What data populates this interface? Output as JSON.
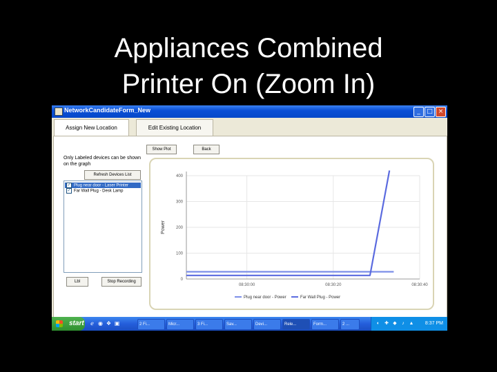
{
  "slide": {
    "title_line1": "Appliances Combined",
    "title_line2": "Printer On (Zoom In)"
  },
  "window": {
    "title": "NetworkCandidateForm_New",
    "controls": {
      "minimize": "_",
      "maximize": "□",
      "close": "×"
    }
  },
  "tabs": [
    {
      "label": "Assign New Location",
      "active": true
    },
    {
      "label": "Edit Existing Location",
      "active": false
    }
  ],
  "toolbar": {
    "btn1": "Show Plot",
    "btn2": "Back"
  },
  "left_panel": {
    "info": "Only Labeled devices can be shown on the graph",
    "refresh_button": "Refresh Devices List",
    "devices": [
      {
        "label": "Plug near door - Laser Printer",
        "checked": true,
        "selected": true
      },
      {
        "label": "Far Wall Plug - Desk Lamp",
        "checked": true,
        "selected": false
      }
    ],
    "bottom_left_button": "Lbl",
    "stop_button": "Stop Recording"
  },
  "chart_data": {
    "type": "line",
    "ylabel": "Power",
    "ylim": [
      0,
      400
    ],
    "yticks": [
      "400",
      "300",
      "200",
      "100",
      "0"
    ],
    "xticks": [
      "08:30:00",
      "08:30:20",
      "08:30:40"
    ],
    "x": [
      0,
      10,
      20,
      30,
      40
    ],
    "series": [
      {
        "name": "Plug near door - Power",
        "color": "#7b8ee8",
        "points": [
          [
            -14,
            28
          ],
          [
            0,
            28
          ],
          [
            10,
            28
          ],
          [
            20,
            28
          ],
          [
            29,
            28
          ],
          [
            34,
            28
          ]
        ]
      },
      {
        "name": "Far Wall Plug - Power",
        "color": "#5a6adf",
        "points": [
          [
            -14,
            14
          ],
          [
            0,
            14
          ],
          [
            10,
            14
          ],
          [
            20,
            14
          ],
          [
            28.5,
            14
          ],
          [
            33,
            420
          ]
        ]
      }
    ],
    "x_range": [
      -14,
      40
    ]
  },
  "taskbar": {
    "start": "start",
    "quick_launch": [
      "ℯ",
      "◉",
      "❖",
      "▣"
    ],
    "tasks": [
      {
        "label": "2 Fi...",
        "active": false
      },
      {
        "label": "Micr...",
        "active": false
      },
      {
        "label": "3 Fi...",
        "active": false
      },
      {
        "label": "Sav...",
        "active": false
      },
      {
        "label": "Devi...",
        "active": false
      },
      {
        "label": "Rele...",
        "active": true
      },
      {
        "label": "Form...",
        "active": false
      },
      {
        "label": "2 ...",
        "active": false
      }
    ],
    "tray_icons": [
      "◐",
      "✚",
      "◆",
      "♪",
      "▲"
    ],
    "clock": "8:37 PM"
  }
}
